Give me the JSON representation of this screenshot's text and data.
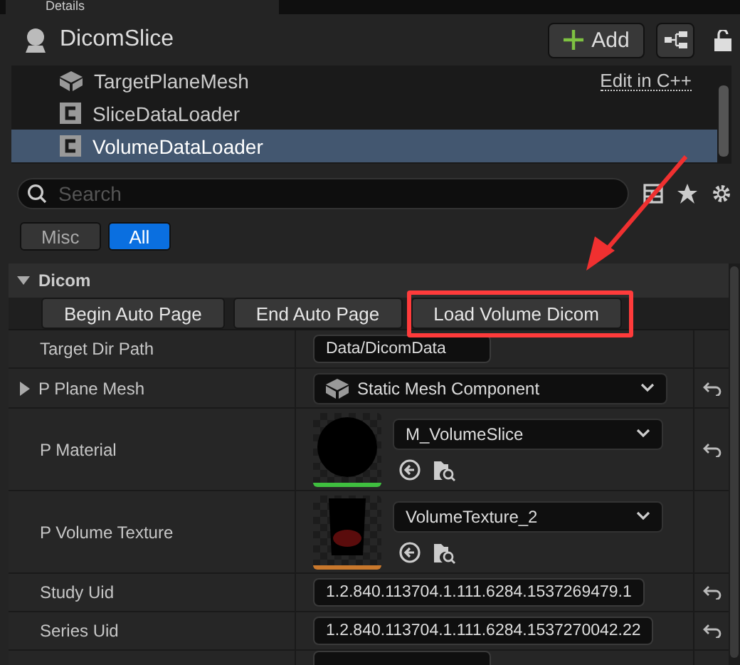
{
  "tab": {
    "title": "Details"
  },
  "header": {
    "title": "DicomSlice",
    "add_button": "Add"
  },
  "components": [
    {
      "name": "TargetPlaneMesh",
      "kind": "mesh",
      "selected": false,
      "action": "Edit in C++"
    },
    {
      "name": "SliceDataLoader",
      "kind": "class",
      "selected": false
    },
    {
      "name": "VolumeDataLoader",
      "kind": "class",
      "selected": true
    }
  ],
  "search": {
    "placeholder": "Search"
  },
  "filters": [
    {
      "label": "Misc",
      "selected": false
    },
    {
      "label": "All",
      "selected": true
    }
  ],
  "category": {
    "name": "Dicom",
    "expanded": true
  },
  "function_buttons": [
    {
      "label": "Begin Auto Page",
      "highlighted": false
    },
    {
      "label": "End Auto Page",
      "highlighted": false
    },
    {
      "label": "Load Volume Dicom",
      "highlighted": true
    }
  ],
  "properties": [
    {
      "name": "Target Dir Path",
      "kind": "text",
      "value": "Data/DicomData",
      "resettable": false
    },
    {
      "name": "P Plane Mesh",
      "kind": "component",
      "value": "Static Mesh Component",
      "resettable": true
    },
    {
      "name": "P Material",
      "kind": "material",
      "value": "M_VolumeSlice",
      "resettable": true
    },
    {
      "name": "P Volume Texture",
      "kind": "texture",
      "value": "VolumeTexture_2",
      "resettable": false
    },
    {
      "name": "Study Uid",
      "kind": "text",
      "value": "1.2.840.113704.1.111.6284.1537269479.1",
      "resettable": true
    },
    {
      "name": "Series Uid",
      "kind": "text",
      "value": "1.2.840.113704.1.111.6284.1537270042.22",
      "resettable": true
    },
    {
      "kind": "cut"
    }
  ]
}
